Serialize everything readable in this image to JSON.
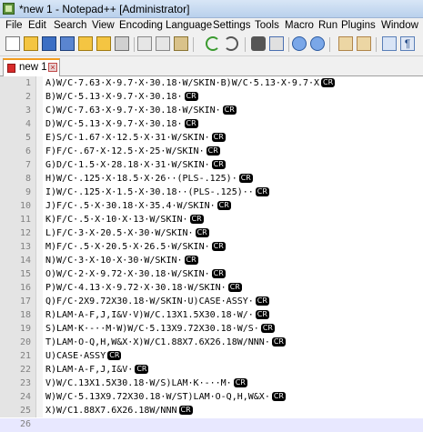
{
  "window": {
    "title": "*new 1 - Notepad++ [Administrator]"
  },
  "menu": [
    "File",
    "Edit",
    "Search",
    "View",
    "Encoding",
    "Language",
    "Settings",
    "Tools",
    "Macro",
    "Run",
    "Plugins",
    "Window"
  ],
  "toolbar": {
    "buttons": [
      "new-file-icon",
      "open-file-icon",
      "save-icon",
      "save-all-icon",
      "close-icon",
      "close-all-icon",
      "print-icon",
      "cut-icon",
      "copy-icon",
      "paste-icon",
      "undo-icon",
      "redo-icon",
      "find-icon",
      "replace-icon",
      "zoom-in-icon",
      "zoom-out-icon",
      "sync-vertical-icon",
      "sync-horizontal-icon",
      "word-wrap-icon",
      "show-all-chars-icon"
    ]
  },
  "tab": {
    "label": "new 1"
  },
  "editor": {
    "line_end_marker": "CR",
    "lines": [
      {
        "n": "1",
        "text": "A)W/C·7.63·X·9.7·X·30.18·W/SKIN·B)W/C·5.13·X·9.7·X",
        "cr": true
      },
      {
        "n": "2",
        "text": "B)W/C·5.13·X·9.7·X·30.18·",
        "cr": true
      },
      {
        "n": "3",
        "text": "C)W/C·7.63·X·9.7·X·30.18·W/SKIN·",
        "cr": true
      },
      {
        "n": "4",
        "text": "D)W/C·5.13·X·9.7·X·30.18·",
        "cr": true
      },
      {
        "n": "5",
        "text": "E)S/C·1.67·X·12.5·X·31·W/SKIN·",
        "cr": true
      },
      {
        "n": "6",
        "text": "F)F/C·.67·X·12.5·X·25·W/SKIN·",
        "cr": true
      },
      {
        "n": "7",
        "text": "G)D/C·1.5·X·28.18·X·31·W/SKIN·",
        "cr": true
      },
      {
        "n": "8",
        "text": "H)W/C·.125·X·18.5·X·26··(PLS-.125)·",
        "cr": true
      },
      {
        "n": "9",
        "text": "I)W/C·.125·X·1.5·X·30.18··(PLS-.125)··",
        "cr": true
      },
      {
        "n": "10",
        "text": "J)F/C·.5·X·30.18·X·35.4·W/SKIN·",
        "cr": true
      },
      {
        "n": "11",
        "text": "K)F/C·.5·X·10·X·13·W/SKIN·",
        "cr": true
      },
      {
        "n": "12",
        "text": "L)F/C·3·X·20.5·X·30·W/SKIN·",
        "cr": true
      },
      {
        "n": "13",
        "text": "M)F/C·.5·X·20.5·X·26.5·W/SKIN·",
        "cr": true
      },
      {
        "n": "14",
        "text": "N)W/C·3·X·10·X·30·W/SKIN·",
        "cr": true
      },
      {
        "n": "15",
        "text": "O)W/C·2·X·9.72·X·30.18·W/SKIN·",
        "cr": true
      },
      {
        "n": "16",
        "text": "P)W/C·4.13·X·9.72·X·30.18·W/SKIN·",
        "cr": true
      },
      {
        "n": "17",
        "text": "Q)F/C·2X9.72X30.18·W/SKIN·U)CASE·ASSY·",
        "cr": true
      },
      {
        "n": "18",
        "text": "R)LAM·A-F,J,I&V·V)W/C.13X1.5X30.18·W/·",
        "cr": true
      },
      {
        "n": "19",
        "text": "S)LAM·K·-··M·W)W/C·5.13X9.72X30.18·W/S·",
        "cr": true
      },
      {
        "n": "20",
        "text": "T)LAM·O-Q,H,W&X·X)W/C1.88X7.6X26.18W/NNN·",
        "cr": true
      },
      {
        "n": "21",
        "text": "U)CASE·ASSY",
        "cr": true
      },
      {
        "n": "22",
        "text": "R)LAM·A-F,J,I&V·",
        "cr": true
      },
      {
        "n": "23",
        "text": "V)W/C.13X1.5X30.18·W/S)LAM·K·-··M·",
        "cr": true
      },
      {
        "n": "24",
        "text": "W)W/C·5.13X9.72X30.18·W/ST)LAM·O-Q,H,W&X·",
        "cr": true
      },
      {
        "n": "25",
        "text": "X)W/C1.88X7.6X26.18W/NNN",
        "cr": true
      },
      {
        "n": "26",
        "text": "",
        "cr": false
      }
    ]
  }
}
